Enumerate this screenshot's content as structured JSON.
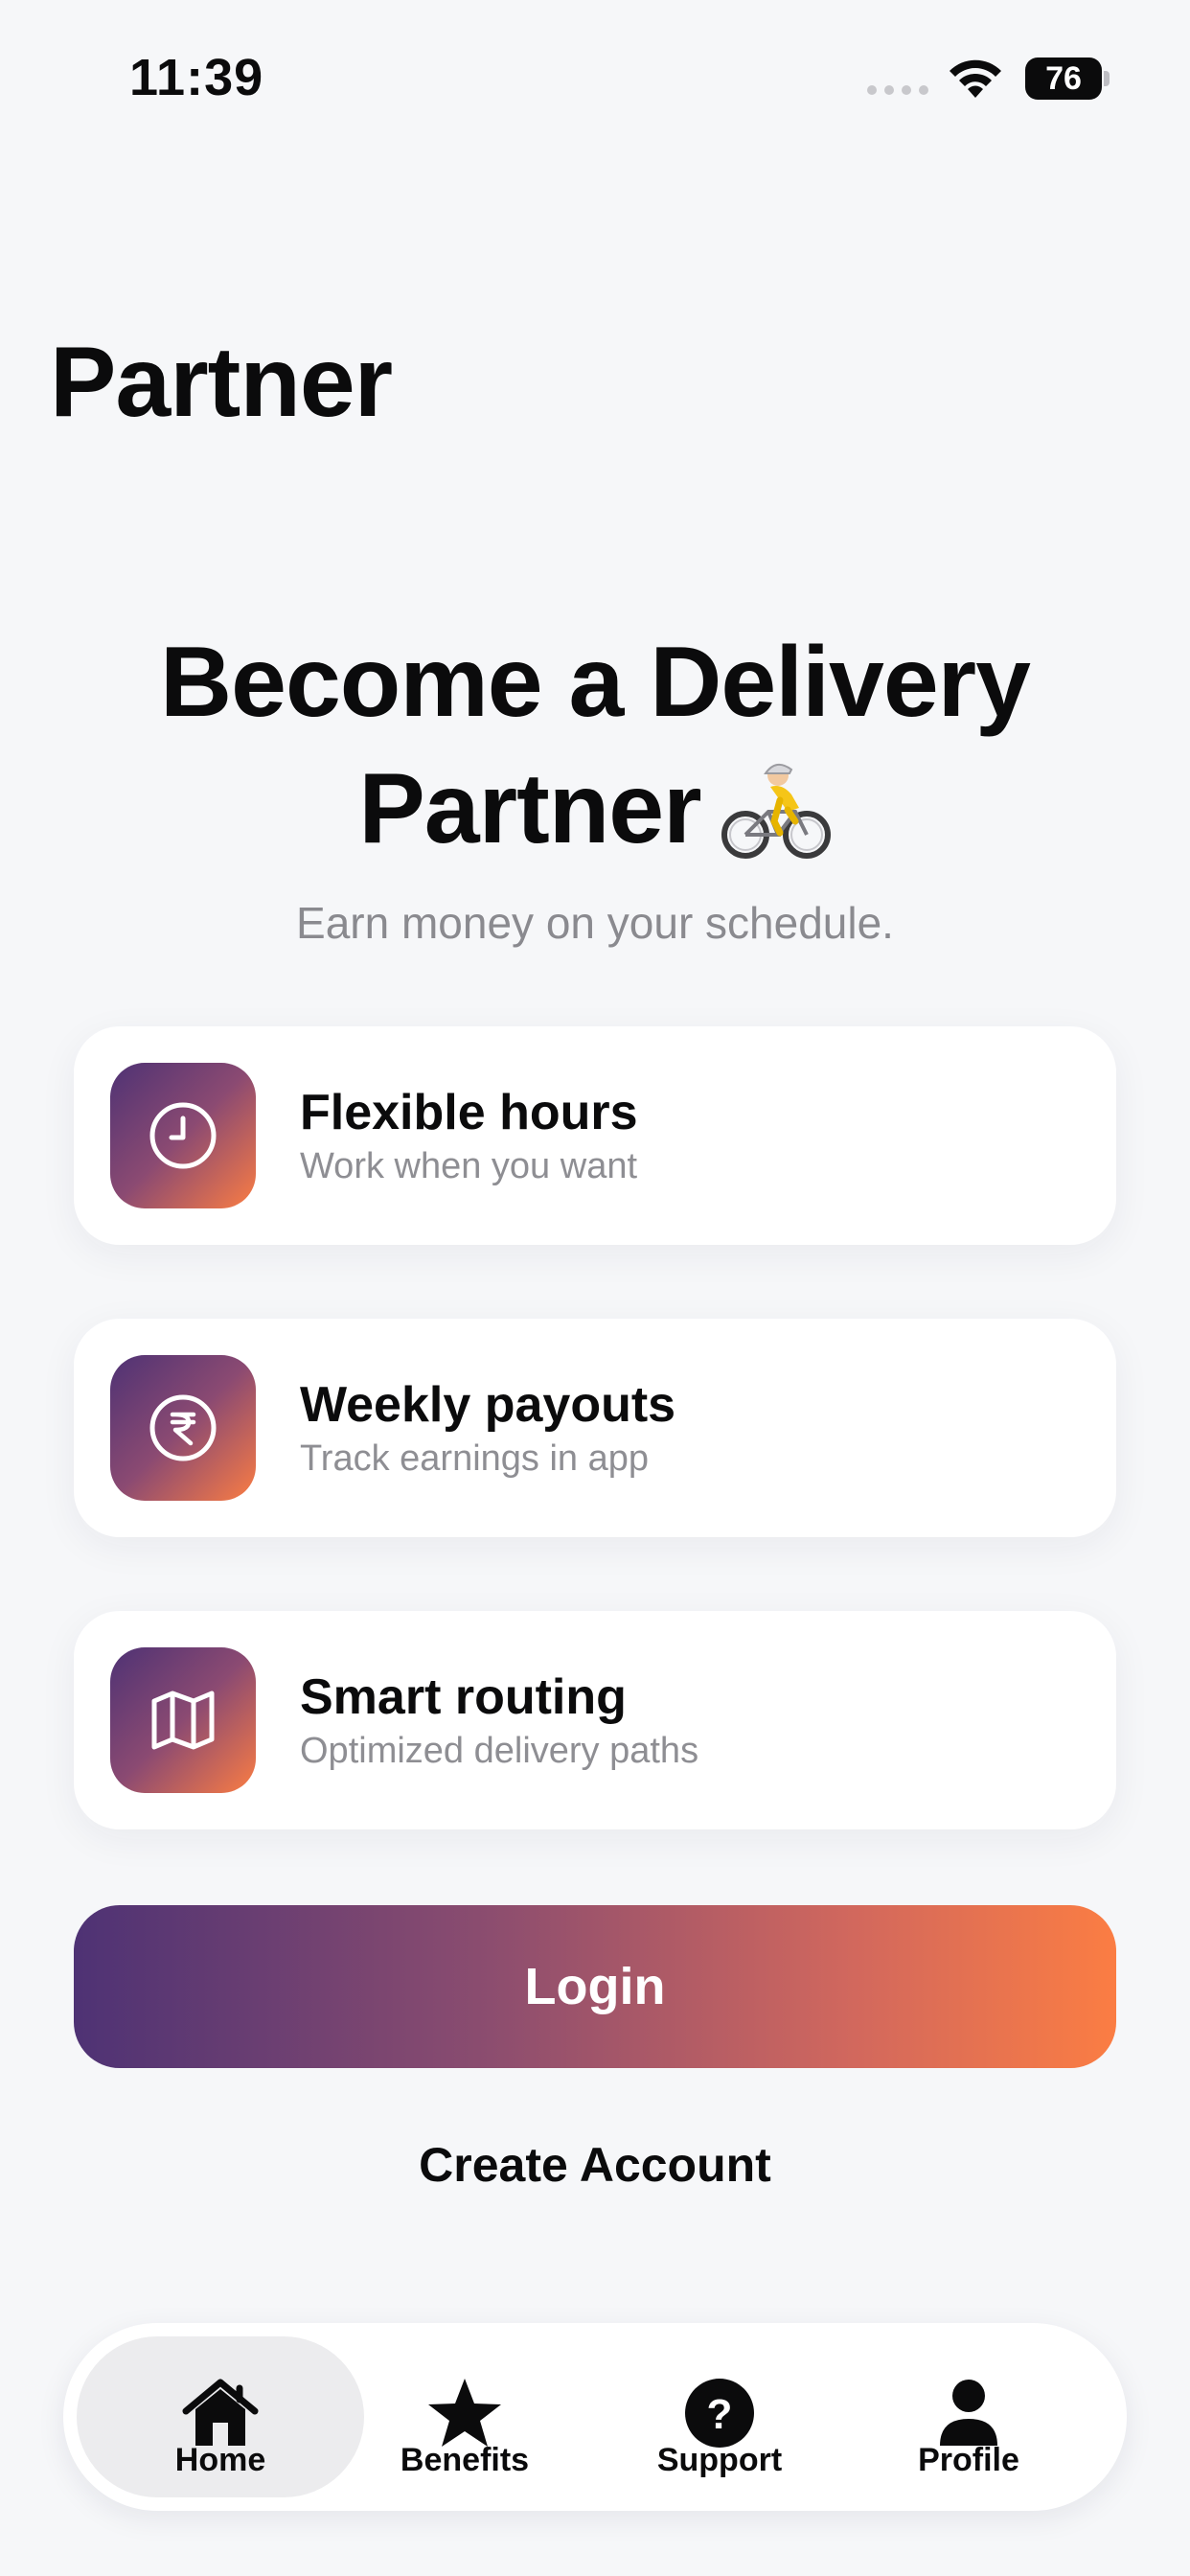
{
  "status_bar": {
    "time": "11:39",
    "battery": "76",
    "icons": [
      "signal-dots-icon",
      "wifi-icon",
      "battery-icon"
    ]
  },
  "page_title": "Partner",
  "hero": {
    "title_line1": "Become a Delivery",
    "title_line2": "Partner",
    "emoji_icon": "bicyclist-icon",
    "subtitle": "Earn money on your schedule."
  },
  "features": [
    {
      "icon": "clock-icon",
      "title": "Flexible hours",
      "description": "Work when you want"
    },
    {
      "icon": "rupee-icon",
      "title": "Weekly payouts",
      "description": "Track earnings in app"
    },
    {
      "icon": "map-icon",
      "title": "Smart routing",
      "description": "Optimized delivery paths"
    }
  ],
  "actions": {
    "login_label": "Login",
    "create_account_label": "Create Account"
  },
  "tab_bar": {
    "active": "Home",
    "tabs": [
      {
        "label": "Home",
        "icon": "house-icon"
      },
      {
        "label": "Benefits",
        "icon": "star-icon"
      },
      {
        "label": "Support",
        "icon": "question-circle-icon"
      },
      {
        "label": "Profile",
        "icon": "person-icon"
      }
    ]
  },
  "colors": {
    "background": "#f6f7f9",
    "gradient_start": "#4e3274",
    "gradient_end": "#fb7d43",
    "secondary_text": "#8e8e93"
  }
}
